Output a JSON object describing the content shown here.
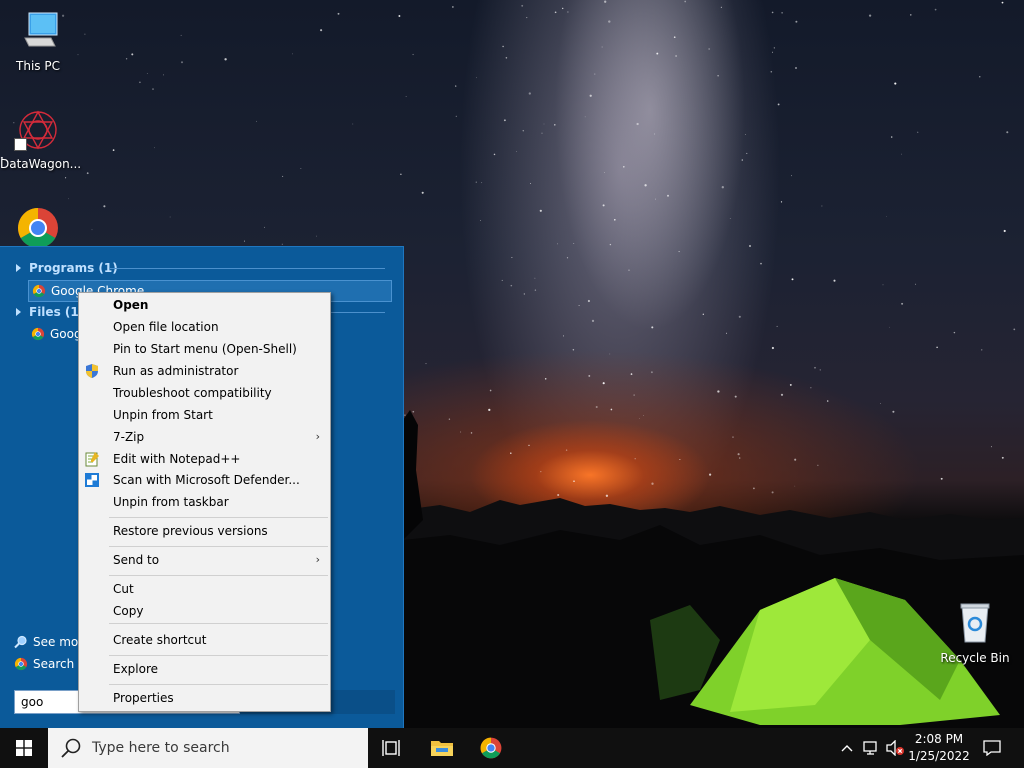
{
  "desktop": {
    "icons": [
      {
        "label": "This PC"
      },
      {
        "label": "DataWagon..."
      },
      {
        "label": ""
      },
      {
        "label": "Recycle Bin"
      }
    ]
  },
  "start_menu": {
    "programs_header": "Programs (1)",
    "programs_item": "Google Chrome",
    "files_header": "Files (1)",
    "files_item": "Goog",
    "see_more": "See mor",
    "search_web": "Search th",
    "search_value": "goo"
  },
  "context_menu": {
    "items": [
      {
        "label": "Open",
        "bold": true
      },
      {
        "label": "Open file location"
      },
      {
        "label": "Pin to Start menu (Open-Shell)"
      },
      {
        "label": "Run as administrator",
        "icon": "shield-icon"
      },
      {
        "label": "Troubleshoot compatibility"
      },
      {
        "label": "Unpin from Start"
      },
      {
        "label": "7-Zip",
        "submenu": true
      },
      {
        "label": "Edit with Notepad++",
        "icon": "notepad-icon"
      },
      {
        "label": "Scan with Microsoft Defender...",
        "icon": "defender-icon"
      },
      {
        "label": "Unpin from taskbar"
      },
      {
        "label": "Restore previous versions"
      },
      {
        "label": "Send to",
        "submenu": true
      },
      {
        "label": "Cut"
      },
      {
        "label": "Copy"
      },
      {
        "label": "Create shortcut"
      },
      {
        "label": "Explore"
      },
      {
        "label": "Properties"
      }
    ],
    "submenu_glyph": "›"
  },
  "taskbar": {
    "search_placeholder": "Type here to search",
    "clock_time": "2:08 PM",
    "clock_date": "1/25/2022"
  },
  "colors": {
    "start_menu_bg": "#0b5a9a",
    "taskbar_bg": "#101010",
    "context_bg": "#f2f2f2"
  }
}
